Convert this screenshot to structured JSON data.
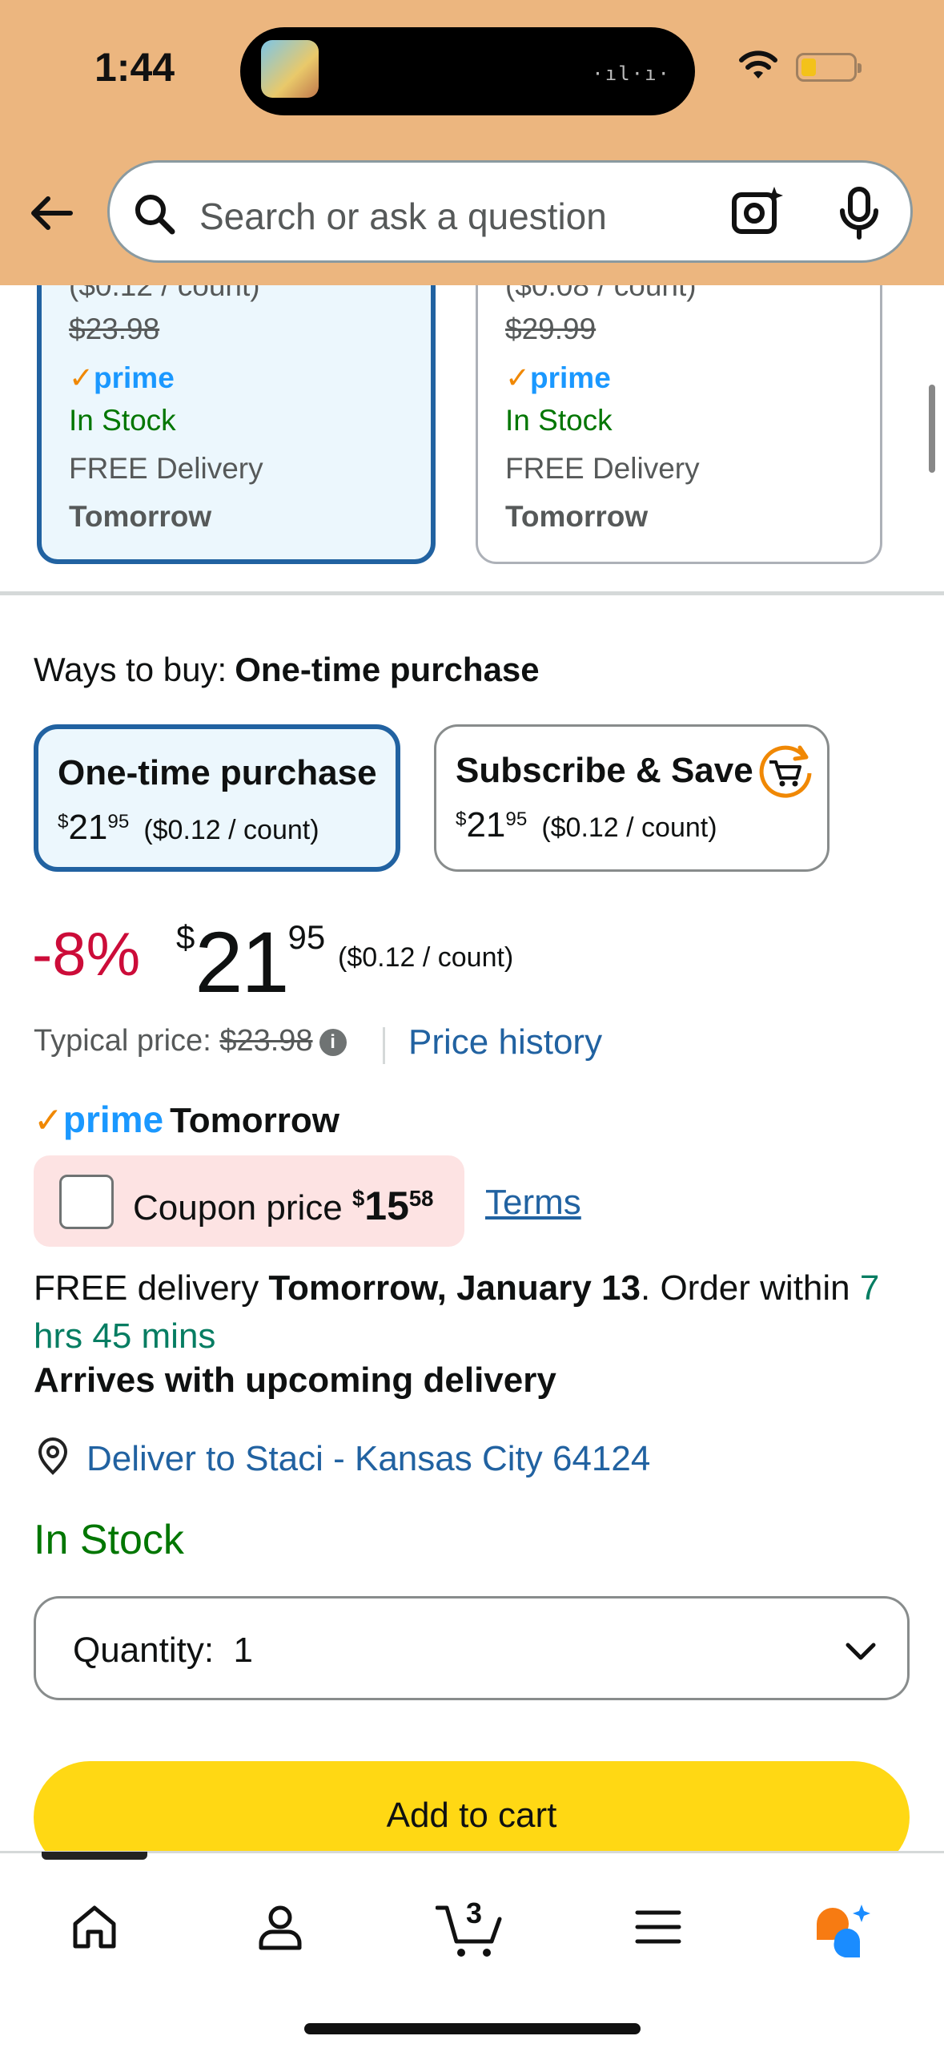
{
  "status_bar": {
    "time": "1:44"
  },
  "header": {
    "search_placeholder": "Search or ask a question"
  },
  "variants": [
    {
      "unit_price_partial": "($0.12 / count)",
      "list_price": "$23.98",
      "prime": "prime",
      "stock": "In Stock",
      "delivery": "FREE Delivery",
      "when": "Tomorrow",
      "selected": true
    },
    {
      "unit_price_partial": "($0.08 / count)",
      "list_price": "$29.99",
      "prime": "prime",
      "stock": "In Stock",
      "delivery": "FREE Delivery",
      "when": "Tomorrow",
      "selected": false
    }
  ],
  "ways_to_buy": {
    "label": "Ways to buy:",
    "selected_value": "One-time purchase",
    "options": [
      {
        "title": "One-time purchase",
        "currency": "$",
        "whole": "21",
        "fraction": "95",
        "unit": "($0.12 / count)"
      },
      {
        "title": "Subscribe & Save",
        "currency": "$",
        "whole": "21",
        "fraction": "95",
        "unit": "($0.12 / count)"
      }
    ]
  },
  "price": {
    "discount": "-8%",
    "currency": "$",
    "whole": "21",
    "fraction": "95",
    "unit": "($0.12 / count)",
    "typical_label": "Typical price:",
    "typical_value": "$23.98",
    "price_history": "Price history"
  },
  "prime_delivery": {
    "prime": "prime",
    "when": "Tomorrow"
  },
  "coupon": {
    "label": "Coupon price",
    "currency": "$",
    "whole": "15",
    "fraction": "58",
    "terms": "Terms"
  },
  "delivery": {
    "prefix": "FREE delivery",
    "date": "Tomorrow, January 13",
    "order_within": ". Order within",
    "countdown": "7 hrs 45 mins",
    "arrives": "Arrives with upcoming delivery",
    "deliver_to": "Deliver to Staci - Kansas City 64124"
  },
  "stock": "In Stock",
  "quantity": {
    "label": "Quantity:",
    "value": "1"
  },
  "add_to_cart": "Add to cart",
  "tabbar": {
    "cart_count": "3"
  },
  "colors": {
    "header_bg": "#ecb67f",
    "link": "#2162a1",
    "in_stock": "#007600",
    "discount": "#cc0c39",
    "add_to_cart": "#ffd814",
    "selected_border": "#2162a1"
  }
}
